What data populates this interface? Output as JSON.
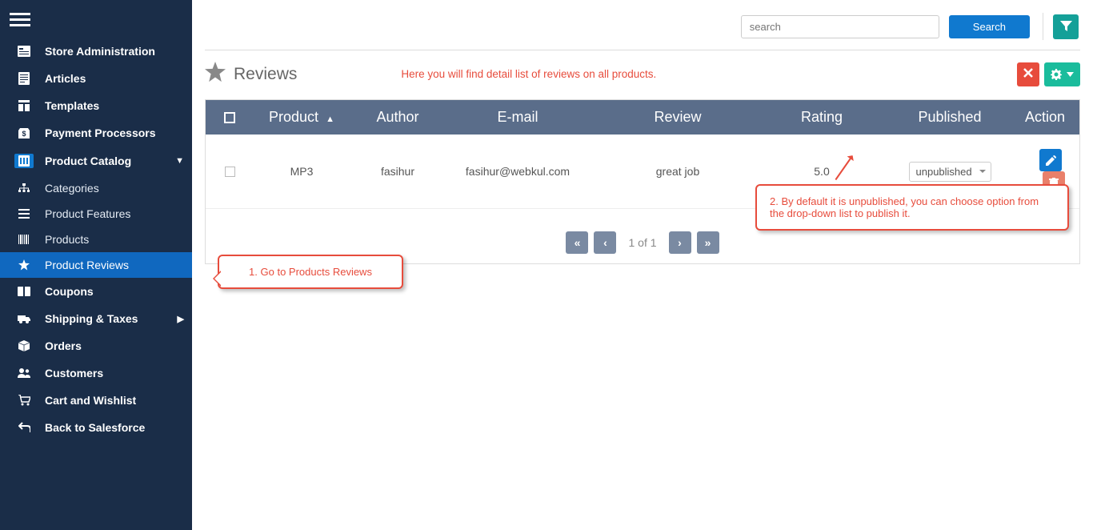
{
  "topbar": {
    "search_placeholder": "search",
    "search_button": "Search"
  },
  "sidebar": {
    "items": [
      {
        "label": "Store Administration"
      },
      {
        "label": "Articles"
      },
      {
        "label": "Templates"
      },
      {
        "label": "Payment Processors"
      },
      {
        "label": "Product Catalog",
        "expanded": true,
        "children": [
          {
            "label": "Categories"
          },
          {
            "label": "Product Features"
          },
          {
            "label": "Products"
          },
          {
            "label": "Product Reviews",
            "active": true
          }
        ]
      },
      {
        "label": "Coupons"
      },
      {
        "label": "Shipping & Taxes"
      },
      {
        "label": "Orders"
      },
      {
        "label": "Customers"
      },
      {
        "label": "Cart and Wishlist"
      },
      {
        "label": "Back to Salesforce"
      }
    ]
  },
  "page": {
    "title": "Reviews",
    "subtitle": "Here you will find detail list of reviews on all products."
  },
  "table": {
    "headers": {
      "product": "Product",
      "author": "Author",
      "email": "E-mail",
      "review": "Review",
      "rating": "Rating",
      "published": "Published",
      "action": "Action"
    },
    "rows": [
      {
        "product": "MP3",
        "author": "fasihur",
        "email": "fasihur@webkul.com",
        "review": "great job",
        "rating": "5.0",
        "published": "unpublished"
      }
    ]
  },
  "pager": {
    "text": "1 of 1"
  },
  "callouts": {
    "c1": "1. Go to Products Reviews",
    "c2": "2. By default it is unpublished, you can choose option from the drop-down list to publish it."
  }
}
